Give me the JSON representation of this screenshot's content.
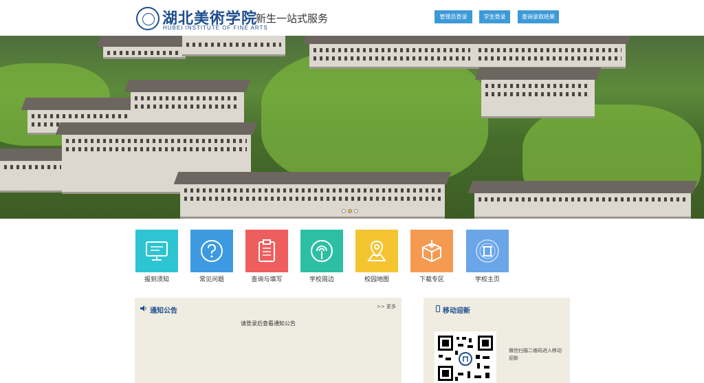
{
  "header": {
    "logo_cn": "湖北美術学院",
    "logo_en": "HUBEI INSTITUTE OF FINE ARTS",
    "subtitle": "新生一站式服务",
    "buttons": [
      {
        "label": "管理员登录"
      },
      {
        "label": "学生登录"
      },
      {
        "label": "查询录取结果"
      }
    ],
    "accent": "#3d9ad8"
  },
  "banner": {
    "toolbar_icons": [
      "bookmark-icon",
      "fullscreen-icon",
      "copy-icon",
      "share-icon",
      "settings-icon"
    ],
    "slide_count": 3,
    "active_slide": 2
  },
  "tiles": [
    {
      "label": "报到须知",
      "icon": "monitor-icon",
      "color": "#2ec5d3"
    },
    {
      "label": "常见问题",
      "icon": "question-icon",
      "color": "#3d9ae0"
    },
    {
      "label": "查询与填写",
      "icon": "clipboard-icon",
      "color": "#ef5e5e"
    },
    {
      "label": "学校周边",
      "icon": "signal-icon",
      "color": "#2cbfa4"
    },
    {
      "label": "校园地图",
      "icon": "map-pin-icon",
      "color": "#f5c431"
    },
    {
      "label": "下载专区",
      "icon": "download-box-icon",
      "color": "#f59a51"
    },
    {
      "label": "学校主页",
      "icon": "school-seal-icon",
      "color": "#6aa5e8"
    }
  ],
  "notice": {
    "title": "通知公告",
    "more": ">> 更多",
    "message": "请登录后查看通知公告"
  },
  "mobile": {
    "title": "移动迎新",
    "qr_caption": "微信扫描二维码进入移动迎新"
  }
}
